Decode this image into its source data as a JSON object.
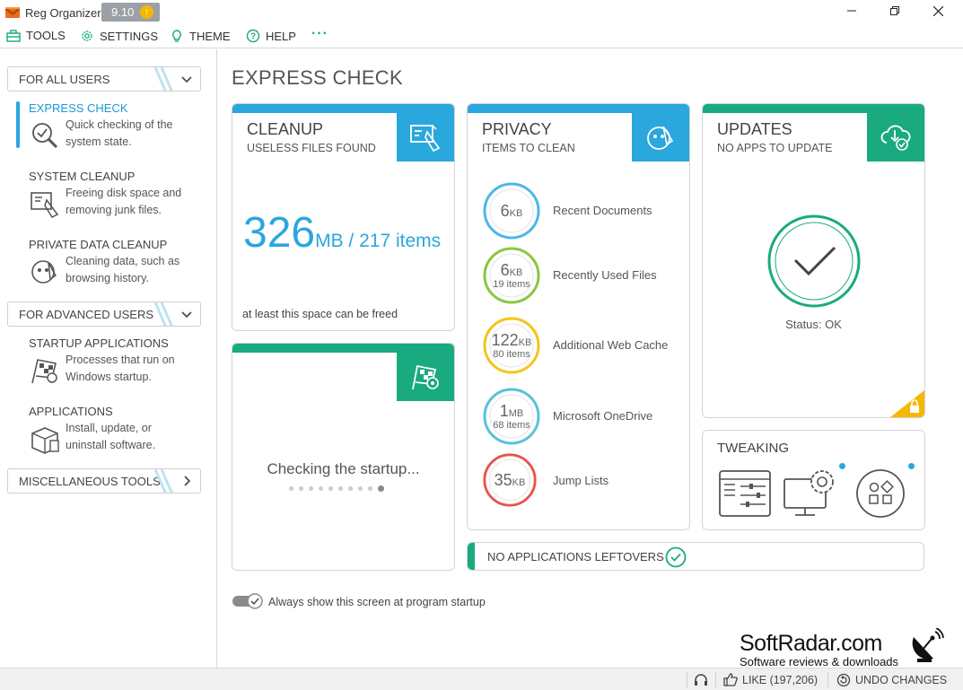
{
  "app": {
    "title": "Reg Organizer",
    "version": "9.10",
    "window_controls": [
      "minimize",
      "maximize",
      "close"
    ]
  },
  "menu": {
    "tools": "TOOLS",
    "settings": "SETTINGS",
    "theme": "THEME",
    "help": "HELP",
    "more": "···"
  },
  "sidebar": {
    "groups": [
      {
        "label": "FOR ALL USERS",
        "expanded": true
      },
      {
        "label": "FOR ADVANCED USERS",
        "expanded": true
      },
      {
        "label": "MISCELLANEOUS TOOLS",
        "expanded": false
      }
    ],
    "items": [
      {
        "title": "EXPRESS CHECK",
        "desc1": "Quick checking of the",
        "desc2": "system state.",
        "active": true,
        "icon": "magnifier-check-icon"
      },
      {
        "title": "SYSTEM CLEANUP",
        "desc1": "Freeing disk space and",
        "desc2": "removing junk files.",
        "icon": "system-cleanup-icon"
      },
      {
        "title": "PRIVATE DATA CLEANUP",
        "desc1": "Cleaning data, such as",
        "desc2": "browsing history.",
        "icon": "private-data-icon"
      },
      {
        "title": "STARTUP APPLICATIONS",
        "desc1": "Processes that run on",
        "desc2": "Windows startup.",
        "icon": "startup-flag-icon"
      },
      {
        "title": "APPLICATIONS",
        "desc1": "Install, update, or",
        "desc2": "uninstall software.",
        "icon": "applications-box-icon"
      }
    ]
  },
  "main": {
    "title": "EXPRESS CHECK",
    "cleanup": {
      "title": "CLEANUP",
      "subtitle": "USELESS FILES FOUND",
      "size": "326",
      "size_unit": "MB",
      "items": " / 217 items",
      "note": "at least this space can be freed",
      "color": "#2aa7dd"
    },
    "privacy": {
      "title": "PRIVACY",
      "subtitle": "ITEMS TO CLEAN",
      "color": "#2aa7dd",
      "rows": [
        {
          "value": "6",
          "unit": "KB",
          "count": "",
          "label": "Recent Documents",
          "color": "#4bb8e8"
        },
        {
          "value": "6",
          "unit": "KB",
          "count": "19 items",
          "label": "Recently Used Files",
          "color": "#8cc63f"
        },
        {
          "value": "122",
          "unit": "KB",
          "count": "80 items",
          "label": "Additional Web Cache",
          "color": "#f5c518"
        },
        {
          "value": "1",
          "unit": "MB",
          "count": "68 items",
          "label": "Microsoft OneDrive",
          "color": "#56c4d6"
        },
        {
          "value": "35",
          "unit": "KB",
          "count": "",
          "label": "Jump Lists",
          "color": "#e8534a"
        }
      ]
    },
    "updates": {
      "title": "UPDATES",
      "subtitle": "NO APPS TO UPDATE",
      "status": "Status: OK",
      "color": "#1aaa80"
    },
    "startup": {
      "checking": "Checking the startup...",
      "color": "#1aaa80"
    },
    "tweaking": {
      "title": "TWEAKING",
      "icons": [
        "settings-panel-icon",
        "computer-gear-icon",
        "apps-grid-icon"
      ]
    },
    "leftovers": {
      "label": "NO APPLICATIONS LEFTOVERS"
    },
    "startup_option": {
      "label": "Always show this screen at program startup",
      "checked": true
    }
  },
  "statusbar": {
    "like": "LIKE (197,206)",
    "undo": "UNDO CHANGES"
  },
  "watermark": {
    "title": "SoftRadar.com",
    "subtitle": "Software reviews & downloads"
  }
}
